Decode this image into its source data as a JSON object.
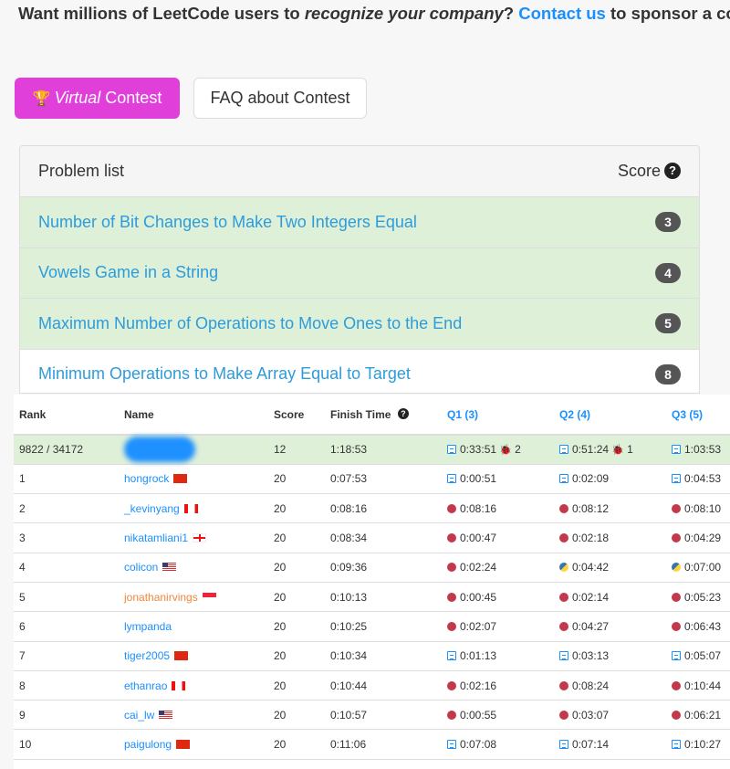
{
  "sponsor": {
    "text_before": "Want millions of LeetCode users to ",
    "italic": "recognize your company",
    "text_mid": "? ",
    "link": "Contact us",
    "text_after": " to sponsor a contest!"
  },
  "buttons": {
    "virtual_italic": "Virtual",
    "virtual_rest": " Contest",
    "faq": "FAQ about Contest"
  },
  "problems": {
    "header": "Problem list",
    "score_header": "Score",
    "items": [
      {
        "title": "Number of Bit Changes to Make Two Integers Equal",
        "score": "3",
        "solved": true
      },
      {
        "title": "Vowels Game in a String",
        "score": "4",
        "solved": true
      },
      {
        "title": "Maximum Number of Operations to Move Ones to the End",
        "score": "5",
        "solved": true
      },
      {
        "title": "Minimum Operations to Make Array Equal to Target",
        "score": "8",
        "solved": false
      }
    ]
  },
  "ranking": {
    "headers": {
      "rank": "Rank",
      "name": "Name",
      "score": "Score",
      "finish": "Finish Time",
      "q1": "Q1 (3)",
      "q2": "Q2 (4)",
      "q3": "Q3 (5)"
    },
    "me": {
      "rank": "9822 / 34172",
      "score": "12",
      "finish": "1:18:53",
      "q1": "0:33:51",
      "q1_bugs": "2",
      "q2": "0:51:24",
      "q2_bugs": "1",
      "q3": "1:03:53"
    },
    "rows": [
      {
        "rank": "1",
        "name": "hongrock",
        "flag": "cn",
        "score": "20",
        "finish": "0:07:53",
        "q1": "0:00:51",
        "q1l": "file",
        "q2": "0:02:09",
        "q2l": "file",
        "q3": "0:04:53",
        "q3l": "file"
      },
      {
        "rank": "2",
        "name": "_kevinyang",
        "flag": "ca",
        "score": "20",
        "finish": "0:08:16",
        "q1": "0:08:16",
        "q1l": "cpp",
        "q2": "0:08:12",
        "q2l": "cpp",
        "q3": "0:08:10",
        "q3l": "cpp"
      },
      {
        "rank": "3",
        "name": "nikatamliani1",
        "flag": "ge",
        "score": "20",
        "finish": "0:08:34",
        "q1": "0:00:47",
        "q1l": "cpp",
        "q2": "0:02:18",
        "q2l": "cpp",
        "q3": "0:04:29",
        "q3l": "cpp"
      },
      {
        "rank": "4",
        "name": "colicon",
        "flag": "us",
        "score": "20",
        "finish": "0:09:36",
        "q1": "0:02:24",
        "q1l": "cpp",
        "q2": "0:04:42",
        "q2l": "py",
        "q3": "0:07:00",
        "q3l": "py"
      },
      {
        "rank": "5",
        "name": "jonathanirvings",
        "flag": "sg",
        "orange": true,
        "score": "20",
        "finish": "0:10:13",
        "q1": "0:00:45",
        "q1l": "cpp",
        "q2": "0:02:14",
        "q2l": "cpp",
        "q3": "0:05:23",
        "q3l": "cpp"
      },
      {
        "rank": "6",
        "name": "lympanda",
        "flag": "",
        "score": "20",
        "finish": "0:10:25",
        "q1": "0:02:07",
        "q1l": "cpp",
        "q2": "0:04:27",
        "q2l": "cpp",
        "q3": "0:06:43",
        "q3l": "cpp"
      },
      {
        "rank": "7",
        "name": "tiger2005",
        "flag": "cn",
        "score": "20",
        "finish": "0:10:34",
        "q1": "0:01:13",
        "q1l": "file",
        "q2": "0:03:13",
        "q2l": "file",
        "q3": "0:05:07",
        "q3l": "file"
      },
      {
        "rank": "8",
        "name": "ethanrao",
        "flag": "ca",
        "score": "20",
        "finish": "0:10:44",
        "q1": "0:02:16",
        "q1l": "cpp",
        "q2": "0:08:24",
        "q2l": "cpp",
        "q3": "0:10:44",
        "q3l": "cpp"
      },
      {
        "rank": "9",
        "name": "cai_lw",
        "flag": "us",
        "score": "20",
        "finish": "0:10:57",
        "q1": "0:00:55",
        "q1l": "cpp",
        "q2": "0:03:07",
        "q2l": "cpp",
        "q3": "0:06:21",
        "q3l": "cpp"
      },
      {
        "rank": "10",
        "name": "paigulong",
        "flag": "cn",
        "score": "20",
        "finish": "0:11:06",
        "q1": "0:07:08",
        "q1l": "file",
        "q2": "0:07:14",
        "q2l": "file",
        "q3": "0:10:27",
        "q3l": "file"
      }
    ]
  }
}
